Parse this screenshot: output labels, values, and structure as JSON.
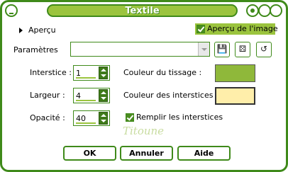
{
  "window": {
    "title": "Textile"
  },
  "preview": {
    "apercu_label": "Aperçu",
    "apercu_image_label": "Aperçu de l'image",
    "apercu_image_checked": true
  },
  "presets": {
    "label": "Paramètres",
    "value": ""
  },
  "fields": {
    "interstice": {
      "label": "Interstice :",
      "value": "1"
    },
    "largeur": {
      "label": "Largeur :",
      "value": "4"
    },
    "opacite": {
      "label": "Opacité :",
      "value": "40"
    }
  },
  "colors": {
    "tissage": {
      "label": "Couleur du tissage :",
      "value": "#8fb83a"
    },
    "interstices": {
      "label": "Couleur des interstices :",
      "value": "#ffeeaa"
    }
  },
  "fill": {
    "label": "Remplir les interstices",
    "checked": true
  },
  "signature": "Titoune",
  "buttons": {
    "ok": "OK",
    "cancel": "Annuler",
    "help": "Aide"
  },
  "theme": {
    "accent": "#3f8a1a",
    "title_bg": "#9bc43e"
  }
}
